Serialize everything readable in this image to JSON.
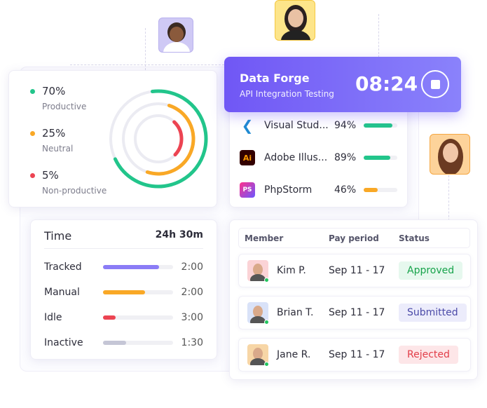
{
  "activity": {
    "items": [
      {
        "percent": "70%",
        "label": "Productive",
        "color": "#22c58b",
        "fraction": 0.7
      },
      {
        "percent": "25%",
        "label": "Neutral",
        "color": "#f9a826",
        "fraction": 0.25
      },
      {
        "percent": "5%",
        "label": "Non-productive",
        "color": "#ec4452",
        "fraction": 0.05
      }
    ]
  },
  "timer": {
    "project": "Data Forge",
    "task": "API Integration Testing",
    "time": "08:24",
    "stop_icon": "stop-icon"
  },
  "apps": [
    {
      "name": "Visual Stud...",
      "percent": "94%",
      "value": 0.94,
      "color": "#22c58b",
      "icon": "vscode-icon"
    },
    {
      "name": "Adobe Illus...",
      "percent": "89%",
      "value": 0.89,
      "color": "#22c58b",
      "icon": "illustrator-icon",
      "icon_text": "Ai"
    },
    {
      "name": "PhpStorm",
      "percent": "46%",
      "value": 0.46,
      "color": "#f9a826",
      "icon": "phpstorm-icon",
      "icon_text": "PS"
    }
  ],
  "time": {
    "title": "Time",
    "total": "24h 30m",
    "rows": [
      {
        "label": "Tracked",
        "value": "2:00",
        "fraction": 0.8,
        "color": "#8b7cf6"
      },
      {
        "label": "Manual",
        "value": "2:00",
        "fraction": 0.6,
        "color": "#f9a826"
      },
      {
        "label": "Idle",
        "value": "3:00",
        "fraction": 0.18,
        "color": "#ec4452"
      },
      {
        "label": "Inactive",
        "value": "1:30",
        "fraction": 0.33,
        "color": "#c5c6d6"
      }
    ]
  },
  "table": {
    "headers": [
      "Member",
      "Pay period",
      "Status"
    ],
    "rows": [
      {
        "name": "Kim P.",
        "period": "Sep 11 - 17",
        "status": "Approved",
        "status_color": "#16a34a",
        "status_bg": "#e6f8ee",
        "avatar_bg": "#fbd3d6"
      },
      {
        "name": "Brian T.",
        "period": "Sep 11 - 17",
        "status": "Submitted",
        "status_color": "#4b4aa8",
        "status_bg": "#ececfb",
        "avatar_bg": "#d9e2f8"
      },
      {
        "name": "Jane R.",
        "period": "Sep 11 - 17",
        "status": "Rejected",
        "status_color": "#e23d48",
        "status_bg": "#fde6e8",
        "avatar_bg": "#f7d6a6"
      }
    ]
  }
}
